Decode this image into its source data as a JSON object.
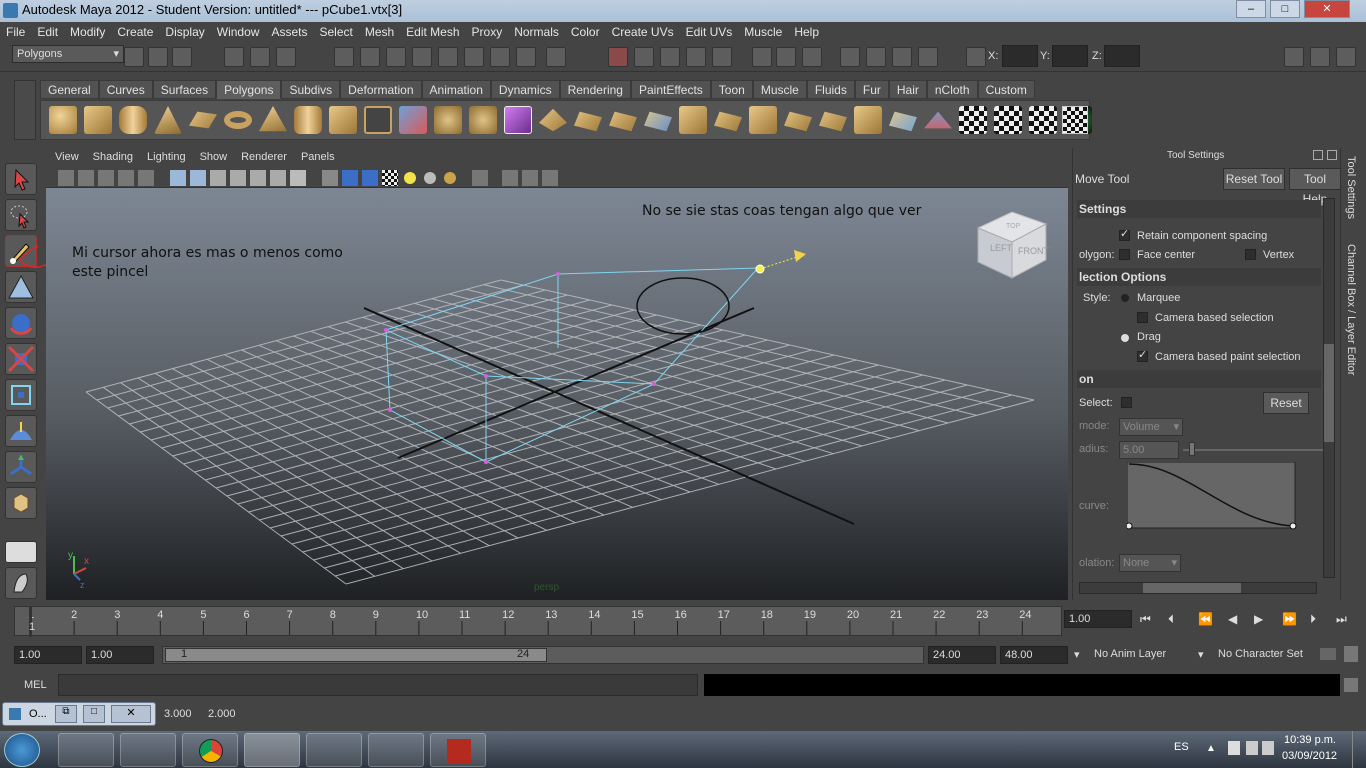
{
  "window": {
    "title": "Autodesk Maya 2012 - Student Version: untitled*   ---   pCube1.vtx[3]",
    "minimize": "–",
    "maximize": "□",
    "close": "✕"
  },
  "menubar": [
    "File",
    "Edit",
    "Modify",
    "Create",
    "Display",
    "Window",
    "Assets",
    "Select",
    "Mesh",
    "Edit Mesh",
    "Proxy",
    "Normals",
    "Color",
    "Create UVs",
    "Edit UVs",
    "Muscle",
    "Help"
  ],
  "status_line": {
    "mode": "Polygons",
    "x_label": "X:",
    "y_label": "Y:",
    "z_label": "Z:"
  },
  "shelf": {
    "tabs": [
      "General",
      "Curves",
      "Surfaces",
      "Polygons",
      "Subdivs",
      "Deformation",
      "Animation",
      "Dynamics",
      "Rendering",
      "PaintEffects",
      "Toon",
      "Muscle",
      "Fluids",
      "Fur",
      "Hair",
      "nCloth",
      "Custom"
    ],
    "active_tab": "Polygons"
  },
  "panel_menu": [
    "View",
    "Shading",
    "Lighting",
    "Show",
    "Renderer",
    "Panels"
  ],
  "viewport": {
    "view_cube_left": "LEFT",
    "view_cube_front": "FRONT",
    "view_cube_top": "TOP",
    "axis_y": "y",
    "axis_x": "x",
    "axis_z": "z",
    "camera_label": "persp",
    "annotation_1_line1": "Mi cursor ahora es mas o menos como",
    "annotation_1_line2": "este pincel",
    "annotation_2": "No se sie stas coas tengan algo que ver"
  },
  "tool_settings": {
    "header": "Tool Settings",
    "tool_name": "Move Tool",
    "reset_tool": "Reset Tool",
    "tool_help": "Tool Help",
    "section_settings": "Settings",
    "retain_spacing": "Retain component spacing",
    "polygon_label": "olygon:",
    "face_center": "Face center",
    "vertex": "Vertex",
    "section_selection": "lection Options",
    "style_label": "Style:",
    "marquee": "Marquee",
    "camera_based_selection": "Camera based selection",
    "drag": "Drag",
    "camera_based_paint": "Camera based paint selection",
    "section_soft": "on",
    "select_label": "Select:",
    "reset": "Reset",
    "mode_label": "mode:",
    "mode_value": "Volume",
    "radius_label": "adius:",
    "radius_value": "5.00",
    "curve_label": "curve:",
    "interp_label": "olation:",
    "interp_value": "None",
    "side_tab_1": "Tool Settings",
    "side_tab_2": "Channel Box / Layer Editor"
  },
  "timeline": {
    "ticks": [
      "1",
      "2",
      "3",
      "4",
      "5",
      "6",
      "7",
      "8",
      "9",
      "10",
      "11",
      "12",
      "13",
      "14",
      "15",
      "16",
      "17",
      "18",
      "19",
      "20",
      "21",
      "22",
      "23",
      "24"
    ],
    "current_frame_marker": "1",
    "current_time": "1.00"
  },
  "range": {
    "start_time": "1.00",
    "playback_start": "1.00",
    "range_start": "1",
    "range_end": "24",
    "playback_end": "24.00",
    "end_time": "48.00",
    "anim_layer": "No Anim Layer",
    "character_set": "No Character Set"
  },
  "command_line": {
    "label": "MEL"
  },
  "help_line": {
    "window_label": "O...",
    "value_1": "3.000",
    "value_2": "2.000"
  },
  "taskbar": {
    "language": "ES",
    "time": "10:39 p.m.",
    "date": "03/09/2012"
  },
  "colors": {
    "wireframe": "#7fd6f2",
    "grid": "#b9bcc0",
    "selected_vertex": "#ffff33"
  }
}
